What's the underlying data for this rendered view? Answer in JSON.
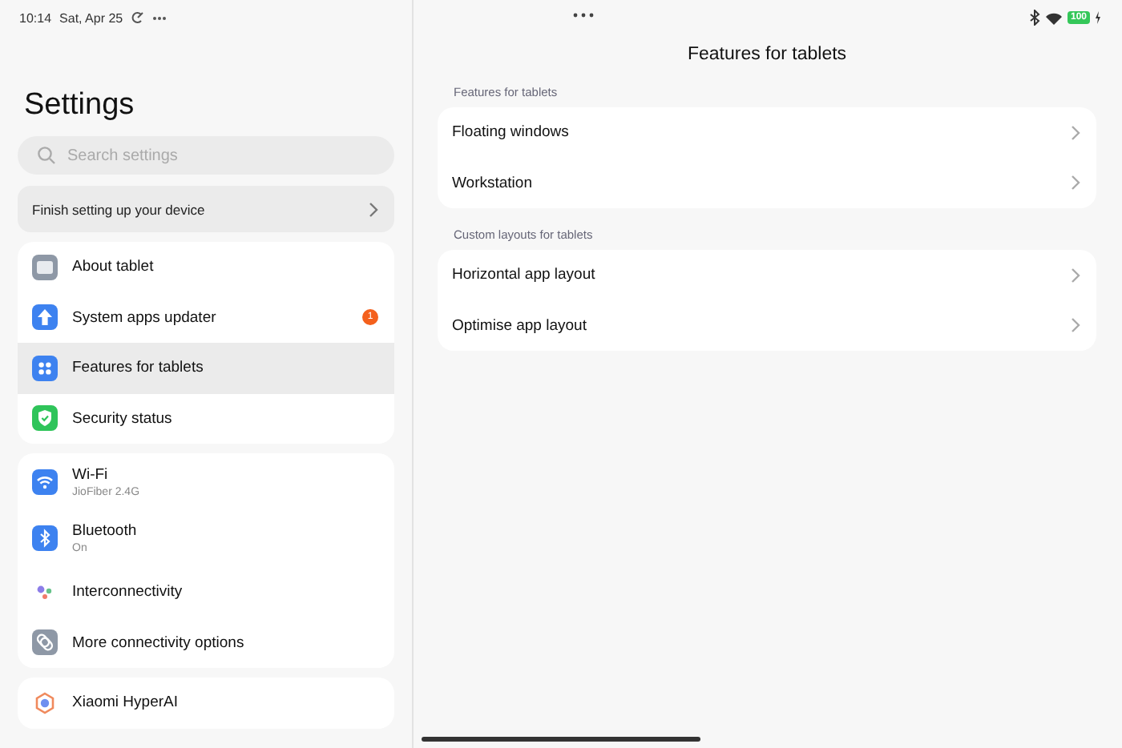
{
  "status_bar": {
    "time": "10:14",
    "date": "Sat, Apr 25",
    "battery": "100"
  },
  "sidebar": {
    "title": "Settings",
    "search": {
      "placeholder": "Search settings"
    },
    "setup_banner": "Finish setting up your device",
    "groups": [
      {
        "items": [
          {
            "label": "About tablet",
            "selected": false
          },
          {
            "label": "System apps updater",
            "badge": "1",
            "selected": false
          },
          {
            "label": "Features for tablets",
            "selected": true
          },
          {
            "label": "Security status",
            "selected": false
          }
        ]
      },
      {
        "items": [
          {
            "label": "Wi-Fi",
            "subtitle": "JioFiber 2.4G",
            "selected": false
          },
          {
            "label": "Bluetooth",
            "subtitle": "On",
            "selected": false
          },
          {
            "label": "Interconnectivity",
            "selected": false
          },
          {
            "label": "More connectivity options",
            "selected": false
          }
        ]
      },
      {
        "items": [
          {
            "label": "Xiaomi HyperAI",
            "selected": false
          }
        ]
      }
    ]
  },
  "detail": {
    "title": "Features for tablets",
    "sections": [
      {
        "heading": "Features for tablets",
        "items": [
          "Floating windows",
          "Workstation"
        ]
      },
      {
        "heading": "Custom layouts for tablets",
        "items": [
          "Horizontal app layout",
          "Optimise app layout"
        ]
      }
    ]
  }
}
